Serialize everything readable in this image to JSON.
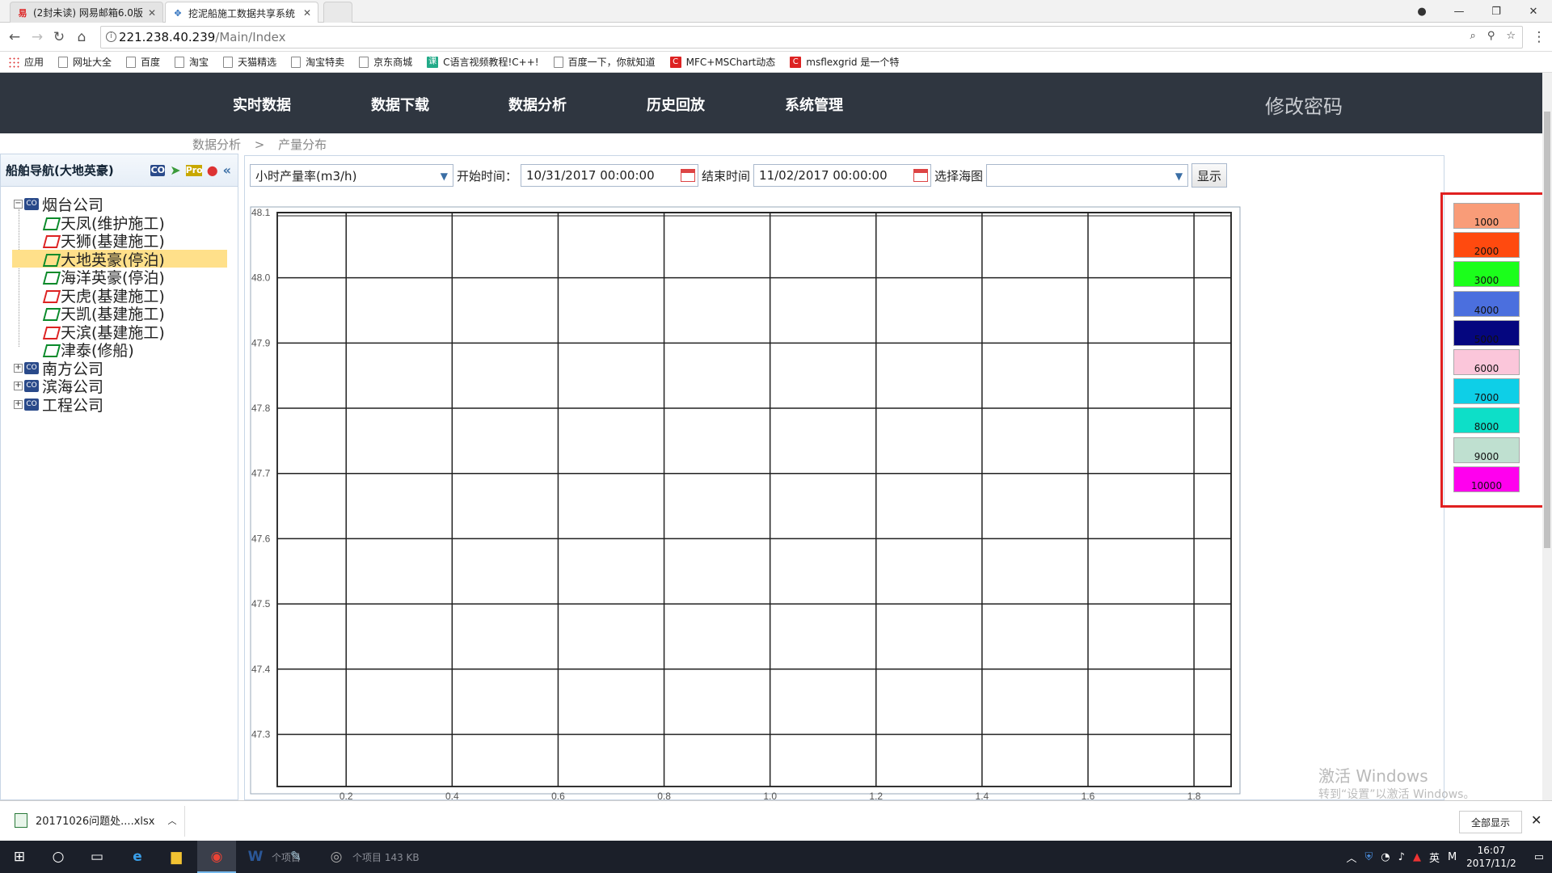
{
  "browser": {
    "tabs": [
      {
        "title": "(2封未读) 网易邮箱6.0版",
        "icon": "netease-mail-icon"
      },
      {
        "title": "挖泥船施工数据共享系统",
        "icon": "app-icon"
      }
    ],
    "url_host": "221.238.40.239",
    "url_path": "/Main/Index",
    "bookmarks": [
      "应用",
      "网址大全",
      "百度",
      "淘宝",
      "天猫精选",
      "淘宝特卖",
      "京东商城",
      "C语言视频教程!C++!",
      "百度一下，你就知道",
      "MFC+MSChart动态",
      "msflexgrid 是一个特"
    ]
  },
  "app": {
    "nav": [
      "实时数据",
      "数据下载",
      "数据分析",
      "历史回放",
      "系统管理"
    ],
    "change_password": "修改密码",
    "breadcrumb": [
      "数据分析",
      ">",
      "产量分布"
    ]
  },
  "sidebar": {
    "title": "船舶导航(大地英豪)",
    "header_icons": [
      "CO",
      "Pro"
    ],
    "tree": [
      {
        "label": "烟台公司",
        "type": "company",
        "expanded": true,
        "children": [
          {
            "label": "天凤(维护施工)",
            "icon": "green"
          },
          {
            "label": "天狮(基建施工)",
            "icon": "red"
          },
          {
            "label": "大地英豪(停泊)",
            "icon": "green",
            "selected": true
          },
          {
            "label": "海洋英豪(停泊)",
            "icon": "green"
          },
          {
            "label": "天虎(基建施工)",
            "icon": "red"
          },
          {
            "label": "天凯(基建施工)",
            "icon": "green"
          },
          {
            "label": "天滨(基建施工)",
            "icon": "red"
          },
          {
            "label": "津泰(修船)",
            "icon": "green"
          }
        ]
      },
      {
        "label": "南方公司",
        "type": "company",
        "expanded": false
      },
      {
        "label": "滨海公司",
        "type": "company",
        "expanded": false
      },
      {
        "label": "工程公司",
        "type": "company",
        "expanded": false
      }
    ]
  },
  "toolbar": {
    "metric_select": "小时产量率(m3/h)",
    "start_label": "开始时间：",
    "start_value": "10/31/2017 00:00:00",
    "end_label": "结束时间",
    "end_value": "11/02/2017 00:00:00",
    "map_label": "选择海图",
    "map_value": "",
    "show_button": "显示"
  },
  "chart_data": {
    "type": "scatter",
    "title": "",
    "xlabel": "",
    "ylabel": "",
    "x_ticks": [
      "0.2",
      "0.4",
      "0.6",
      "0.8",
      "1.0",
      "1.2",
      "1.4",
      "1.6",
      "1.8"
    ],
    "y_ticks": [
      "48.1",
      "48.0",
      "47.9",
      "47.8",
      "47.7",
      "47.6",
      "47.5",
      "47.4",
      "47.3"
    ],
    "xlim": [
      0.07,
      1.87
    ],
    "ylim": [
      47.22,
      48.1
    ],
    "grid": true,
    "series": []
  },
  "legend": {
    "items": [
      {
        "label": "1000",
        "color": "#f99c78"
      },
      {
        "label": "2000",
        "color": "#ff4a0f"
      },
      {
        "label": "3000",
        "color": "#1bff1b"
      },
      {
        "label": "4000",
        "color": "#4b6fde"
      },
      {
        "label": "5000",
        "color": "#05067f"
      },
      {
        "label": "6000",
        "color": "#fbc6da"
      },
      {
        "label": "7000",
        "color": "#0ecfe7"
      },
      {
        "label": "8000",
        "color": "#0ddfc8"
      },
      {
        "label": "9000",
        "color": "#bfe0d0"
      },
      {
        "label": "10000",
        "color": "#ff00ee"
      }
    ],
    "highlight_color": "#e02020"
  },
  "watermark": {
    "line1": "激活 Windows",
    "line2": "转到“设置”以激活 Windows。"
  },
  "download": {
    "filename": "20171026问题处....xlsx",
    "show_all": "全部显示"
  },
  "taskbar": {
    "ghost_text_1": "个项目",
    "ghost_text_2": "个项目 143 KB",
    "time": "16:07",
    "date": "2017/11/2",
    "ime": "英",
    "ime2": "M"
  }
}
